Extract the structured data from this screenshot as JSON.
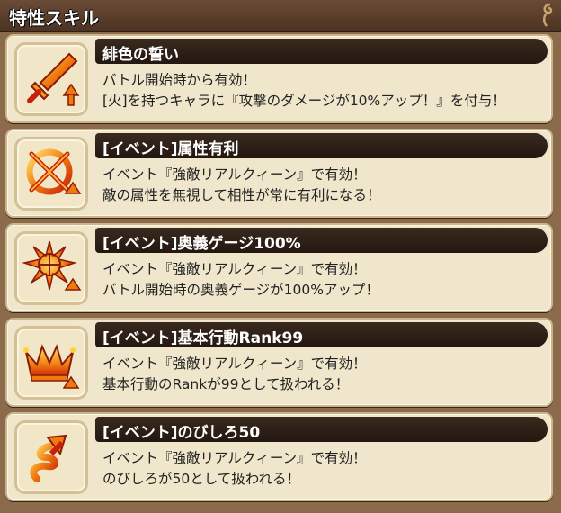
{
  "header": {
    "title": "特性スキル"
  },
  "skills": [
    {
      "name": "緋色の誓い",
      "icon": "sword-icon",
      "lines": [
        "バトル開始時から有効！",
        "[火]を持つキャラに『攻撃のダメージが10%アップ！』を付与！"
      ]
    },
    {
      "name": "[イベント]属性有利",
      "icon": "element-advantage-icon",
      "lines": [
        "イベント『強敵リアルクィーン』で有効！",
        "敵の属性を無視して相性が常に有利になる！"
      ]
    },
    {
      "name": "[イベント]奥義ゲージ100%",
      "icon": "burst-gauge-icon",
      "lines": [
        "イベント『強敵リアルクィーン』で有効！",
        "バトル開始時の奥義ゲージが100%アップ！"
      ]
    },
    {
      "name": "[イベント]基本行動Rank99",
      "icon": "crown-icon",
      "lines": [
        "イベント『強敵リアルクィーン』で有効！",
        "基本行動のRankが99として扱われる！"
      ]
    },
    {
      "name": "[イベント]のびしろ50",
      "icon": "spiral-arrow-icon",
      "lines": [
        "イベント『強敵リアルクィーン』で有効！",
        "のびしろが50として扱われる！"
      ]
    }
  ],
  "colors": {
    "icon_orange": "#f07a10",
    "icon_red": "#c8200a",
    "icon_yellow": "#ffd23a"
  }
}
